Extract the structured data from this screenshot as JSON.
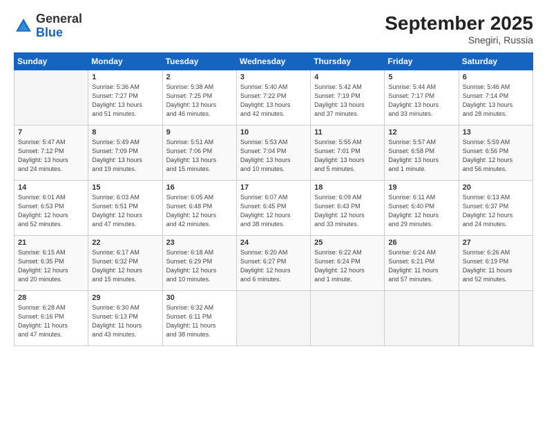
{
  "header": {
    "logo_general": "General",
    "logo_blue": "Blue",
    "month_title": "September 2025",
    "location": "Snegiri, Russia"
  },
  "days_of_week": [
    "Sunday",
    "Monday",
    "Tuesday",
    "Wednesday",
    "Thursday",
    "Friday",
    "Saturday"
  ],
  "weeks": [
    [
      {
        "day": "",
        "info": ""
      },
      {
        "day": "1",
        "info": "Sunrise: 5:36 AM\nSunset: 7:27 PM\nDaylight: 13 hours\nand 51 minutes."
      },
      {
        "day": "2",
        "info": "Sunrise: 5:38 AM\nSunset: 7:25 PM\nDaylight: 13 hours\nand 46 minutes."
      },
      {
        "day": "3",
        "info": "Sunrise: 5:40 AM\nSunset: 7:22 PM\nDaylight: 13 hours\nand 42 minutes."
      },
      {
        "day": "4",
        "info": "Sunrise: 5:42 AM\nSunset: 7:19 PM\nDaylight: 13 hours\nand 37 minutes."
      },
      {
        "day": "5",
        "info": "Sunrise: 5:44 AM\nSunset: 7:17 PM\nDaylight: 13 hours\nand 33 minutes."
      },
      {
        "day": "6",
        "info": "Sunrise: 5:46 AM\nSunset: 7:14 PM\nDaylight: 13 hours\nand 28 minutes."
      }
    ],
    [
      {
        "day": "7",
        "info": "Sunrise: 5:47 AM\nSunset: 7:12 PM\nDaylight: 13 hours\nand 24 minutes."
      },
      {
        "day": "8",
        "info": "Sunrise: 5:49 AM\nSunset: 7:09 PM\nDaylight: 13 hours\nand 19 minutes."
      },
      {
        "day": "9",
        "info": "Sunrise: 5:51 AM\nSunset: 7:06 PM\nDaylight: 13 hours\nand 15 minutes."
      },
      {
        "day": "10",
        "info": "Sunrise: 5:53 AM\nSunset: 7:04 PM\nDaylight: 13 hours\nand 10 minutes."
      },
      {
        "day": "11",
        "info": "Sunrise: 5:55 AM\nSunset: 7:01 PM\nDaylight: 13 hours\nand 5 minutes."
      },
      {
        "day": "12",
        "info": "Sunrise: 5:57 AM\nSunset: 6:58 PM\nDaylight: 13 hours\nand 1 minute."
      },
      {
        "day": "13",
        "info": "Sunrise: 5:59 AM\nSunset: 6:56 PM\nDaylight: 12 hours\nand 56 minutes."
      }
    ],
    [
      {
        "day": "14",
        "info": "Sunrise: 6:01 AM\nSunset: 6:53 PM\nDaylight: 12 hours\nand 52 minutes."
      },
      {
        "day": "15",
        "info": "Sunrise: 6:03 AM\nSunset: 6:51 PM\nDaylight: 12 hours\nand 47 minutes."
      },
      {
        "day": "16",
        "info": "Sunrise: 6:05 AM\nSunset: 6:48 PM\nDaylight: 12 hours\nand 42 minutes."
      },
      {
        "day": "17",
        "info": "Sunrise: 6:07 AM\nSunset: 6:45 PM\nDaylight: 12 hours\nand 38 minutes."
      },
      {
        "day": "18",
        "info": "Sunrise: 6:09 AM\nSunset: 6:43 PM\nDaylight: 12 hours\nand 33 minutes."
      },
      {
        "day": "19",
        "info": "Sunrise: 6:11 AM\nSunset: 6:40 PM\nDaylight: 12 hours\nand 29 minutes."
      },
      {
        "day": "20",
        "info": "Sunrise: 6:13 AM\nSunset: 6:37 PM\nDaylight: 12 hours\nand 24 minutes."
      }
    ],
    [
      {
        "day": "21",
        "info": "Sunrise: 6:15 AM\nSunset: 6:35 PM\nDaylight: 12 hours\nand 20 minutes."
      },
      {
        "day": "22",
        "info": "Sunrise: 6:17 AM\nSunset: 6:32 PM\nDaylight: 12 hours\nand 15 minutes."
      },
      {
        "day": "23",
        "info": "Sunrise: 6:18 AM\nSunset: 6:29 PM\nDaylight: 12 hours\nand 10 minutes."
      },
      {
        "day": "24",
        "info": "Sunrise: 6:20 AM\nSunset: 6:27 PM\nDaylight: 12 hours\nand 6 minutes."
      },
      {
        "day": "25",
        "info": "Sunrise: 6:22 AM\nSunset: 6:24 PM\nDaylight: 12 hours\nand 1 minute."
      },
      {
        "day": "26",
        "info": "Sunrise: 6:24 AM\nSunset: 6:21 PM\nDaylight: 11 hours\nand 57 minutes."
      },
      {
        "day": "27",
        "info": "Sunrise: 6:26 AM\nSunset: 6:19 PM\nDaylight: 11 hours\nand 52 minutes."
      }
    ],
    [
      {
        "day": "28",
        "info": "Sunrise: 6:28 AM\nSunset: 6:16 PM\nDaylight: 11 hours\nand 47 minutes."
      },
      {
        "day": "29",
        "info": "Sunrise: 6:30 AM\nSunset: 6:13 PM\nDaylight: 11 hours\nand 43 minutes."
      },
      {
        "day": "30",
        "info": "Sunrise: 6:32 AM\nSunset: 6:11 PM\nDaylight: 11 hours\nand 38 minutes."
      },
      {
        "day": "",
        "info": ""
      },
      {
        "day": "",
        "info": ""
      },
      {
        "day": "",
        "info": ""
      },
      {
        "day": "",
        "info": ""
      }
    ]
  ]
}
